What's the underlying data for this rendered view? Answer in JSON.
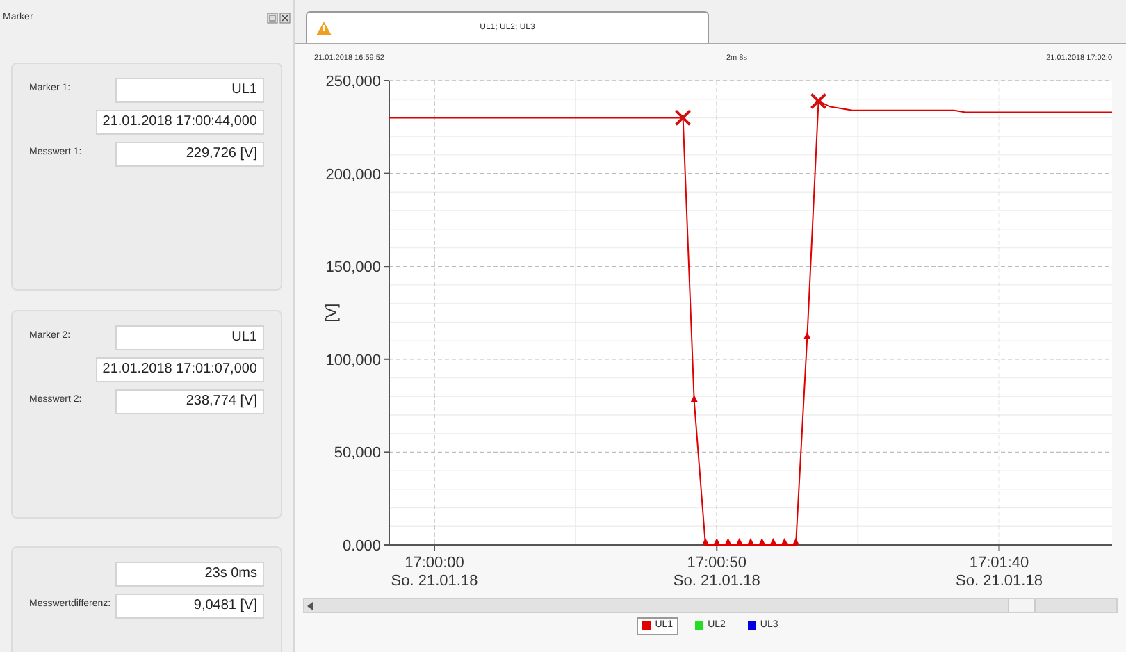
{
  "panel": {
    "title": "Marker",
    "groups": [
      {
        "rows": [
          {
            "label": "Marker 1:",
            "value": "UL1"
          },
          {
            "value": "21.01.2018 17:00:44,000"
          },
          {
            "label": "Messwert 1:",
            "value": "229,726 [V]"
          }
        ]
      },
      {
        "rows": [
          {
            "label": "Marker 2:",
            "value": "UL1"
          },
          {
            "value": "21.01.2018 17:01:07,000"
          },
          {
            "label": "Messwert 2:",
            "value": "238,774 [V]"
          }
        ]
      },
      {
        "rows": [
          {
            "value": "23s 0ms"
          },
          {
            "label": "Messwertdifferenz:",
            "value": "9,0481 [V]"
          }
        ]
      }
    ]
  },
  "tabs": [
    {
      "label": "UL1; UL2; UL3",
      "selected": true
    }
  ],
  "chart": {
    "header": {
      "start": "21.01.2018 16:59:52",
      "span": "2m 8s",
      "end": "21.01.2018 17:02:0"
    },
    "chart_data": {
      "type": "line",
      "ylabel": "[V]",
      "ylim": [
        0,
        250000
      ],
      "grid": true,
      "yticks": [
        {
          "value": 0,
          "label": "0.000"
        },
        {
          "value": 50000,
          "label": "50,000"
        },
        {
          "value": 100000,
          "label": "100,000"
        },
        {
          "value": 150000,
          "label": "150,000"
        },
        {
          "value": 200000,
          "label": "200,000"
        },
        {
          "value": 250000,
          "label": "250,000"
        }
      ],
      "categories": [
        null,
        null,
        null,
        null,
        "17:00:00\nSo. 21.01.18",
        null,
        null,
        null,
        null,
        null,
        null,
        null,
        null,
        null,
        null,
        null,
        null,
        null,
        null,
        null,
        null,
        null,
        null,
        null,
        null,
        null,
        null,
        null,
        null,
        "17:00:50\nSo. 21.01.18",
        null,
        null,
        null,
        null,
        null,
        null,
        null,
        null,
        null,
        null,
        null,
        null,
        null,
        null,
        null,
        null,
        null,
        null,
        null,
        null,
        null,
        null,
        null,
        null,
        "17:01:40\nSo. 21.01.18",
        null,
        null,
        null,
        null,
        null,
        null,
        null,
        null,
        null,
        null
      ],
      "series": [
        {
          "name": "UL1",
          "color": "#e00000",
          "values": [
            230000,
            230000,
            230000,
            230000,
            230000,
            230000,
            230000,
            230000,
            230000,
            230000,
            230000,
            230000,
            230000,
            230000,
            230000,
            230000,
            230000,
            230000,
            230000,
            230000,
            230000,
            230000,
            230000,
            230000,
            230000,
            230000,
            230000,
            77000,
            0,
            0,
            0,
            0,
            0,
            0,
            0,
            0,
            0,
            111000,
            239000,
            236000,
            235000,
            234000,
            234000,
            234000,
            234000,
            234000,
            234000,
            234000,
            234000,
            234000,
            234000,
            233000,
            233000,
            233000,
            233000,
            233000,
            233000,
            233000,
            233000,
            233000,
            233000,
            233000,
            233000,
            233000,
            233000
          ]
        }
      ]
    }
  },
  "legend": [
    {
      "selected": true
    },
    {
      "label": "UL2",
      "color": "#22dd22",
      "selected": false
    },
    {
      "label": "UL3",
      "color": "#0000dd",
      "selected": false
    }
  ]
}
